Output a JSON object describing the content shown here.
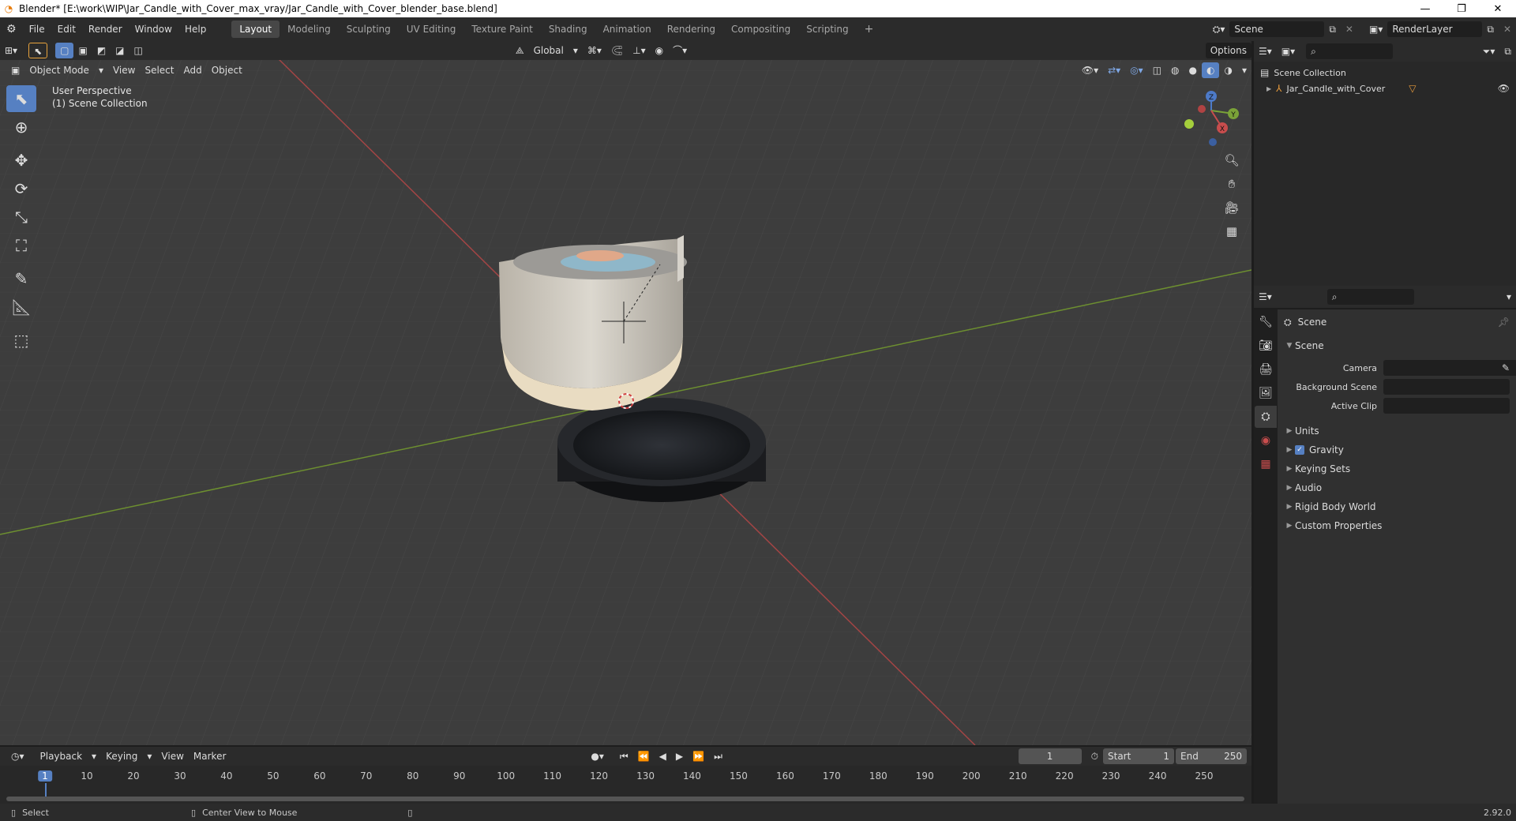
{
  "title_bar": {
    "text": "Blender* [E:\\work\\WIP\\Jar_Candle_with_Cover_max_vray/Jar_Candle_with_Cover_blender_base.blend]",
    "minimize": "—",
    "restore": "❐",
    "close": "✕"
  },
  "menu": [
    "File",
    "Edit",
    "Render",
    "Window",
    "Help"
  ],
  "workspaces": [
    "Layout",
    "Modeling",
    "Sculpting",
    "UV Editing",
    "Texture Paint",
    "Shading",
    "Animation",
    "Rendering",
    "Compositing",
    "Scripting"
  ],
  "active_workspace": "Layout",
  "scene_field": "Scene",
  "render_layer_field": "RenderLayer",
  "viewport": {
    "transform_orientation": "Global",
    "options_label": "Options",
    "mode": "Object Mode",
    "header_menus": [
      "View",
      "Select",
      "Add",
      "Object"
    ],
    "overlay_text_1": "User Perspective",
    "overlay_text_2": "(1) Scene Collection",
    "gizmo_axes": {
      "x": "X",
      "y": "Y",
      "z": "Z"
    }
  },
  "outliner": {
    "root": "Scene Collection",
    "items": [
      {
        "label": "Jar_Candle_with_Cover"
      }
    ]
  },
  "properties": {
    "context": "Scene",
    "panel_title": "Scene",
    "fields": [
      {
        "label": "Camera",
        "value": ""
      },
      {
        "label": "Background Scene",
        "value": ""
      },
      {
        "label": "Active Clip",
        "value": ""
      }
    ],
    "sub_panels": [
      "Units",
      "Gravity",
      "Keying Sets",
      "Audio",
      "Rigid Body World",
      "Custom Properties"
    ],
    "gravity_checked": true
  },
  "timeline": {
    "menus": [
      "Playback",
      "Keying",
      "View",
      "Marker"
    ],
    "current_frame": "1",
    "start_label": "Start",
    "start": "1",
    "end_label": "End",
    "end": "250",
    "ticks": [
      "1",
      "10",
      "20",
      "30",
      "40",
      "50",
      "60",
      "70",
      "80",
      "90",
      "100",
      "110",
      "120",
      "130",
      "140",
      "150",
      "160",
      "170",
      "180",
      "190",
      "200",
      "210",
      "220",
      "230",
      "240",
      "250"
    ]
  },
  "status_bar": {
    "left_action": "Select",
    "mid_action": "Center View to Mouse",
    "version": "2.92.0"
  },
  "colors": {
    "accent": "#5680c2",
    "x_axis": "#c84d4d",
    "y_axis": "#7aa238",
    "z_axis": "#4d7ac8"
  }
}
